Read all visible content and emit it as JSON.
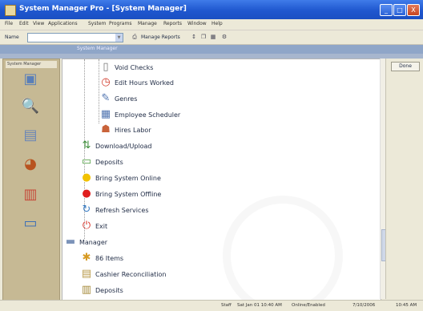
{
  "window": {
    "title": "System Manager Pro - [System Manager]",
    "controls": [
      "_",
      "□",
      "X"
    ]
  },
  "menu": [
    "File",
    "Edit",
    "View",
    "Applications",
    "System",
    "Programs",
    "Manage",
    "Reports",
    "Window",
    "Help"
  ],
  "toolbar": {
    "label": "Name",
    "combo_value": "",
    "print_label": "Manage Reports"
  },
  "header": {
    "title": "System Manager"
  },
  "left_pane": {
    "header": "System Manager",
    "items": [
      {
        "icon": "monitor-icon",
        "glyph": "▣"
      },
      {
        "icon": "magnifier-icon",
        "glyph": "🔍"
      },
      {
        "icon": "clipboard-icon",
        "glyph": "▤"
      },
      {
        "icon": "globe-icon",
        "glyph": "◕"
      },
      {
        "icon": "chart-icon",
        "glyph": "▥"
      },
      {
        "icon": "card-icon",
        "glyph": "▭"
      }
    ]
  },
  "tree": {
    "items": [
      {
        "label": "Void Checks",
        "level": 2,
        "icon": "document-icon",
        "glyph": "▯"
      },
      {
        "label": "Edit Hours Worked",
        "level": 2,
        "icon": "clock-icon",
        "glyph": "◷"
      },
      {
        "label": "Genres",
        "level": 2,
        "icon": "notepad-icon",
        "glyph": "✎"
      },
      {
        "label": "Employee Scheduler",
        "level": 2,
        "icon": "calendar-icon",
        "glyph": "▦"
      },
      {
        "label": "Hires Labor",
        "level": 2,
        "icon": "labor-icon",
        "glyph": "☗"
      },
      {
        "label": "Download/Upload",
        "level": 1,
        "icon": "transfer-icon",
        "glyph": "⇅"
      },
      {
        "label": "Deposits",
        "level": 1,
        "icon": "money-icon",
        "glyph": "▭"
      },
      {
        "label": "Bring System Online",
        "level": 1,
        "icon": "online-icon",
        "glyph": "●"
      },
      {
        "label": "Bring System Offline",
        "level": 1,
        "icon": "offline-icon",
        "glyph": "●"
      },
      {
        "label": "Refresh Services",
        "level": 1,
        "icon": "refresh-icon",
        "glyph": "↻"
      },
      {
        "label": "Exit",
        "level": 1,
        "icon": "exit-icon",
        "glyph": "⏻"
      },
      {
        "label": "Manager",
        "level": 0,
        "icon": "folder-icon",
        "glyph": "▬"
      },
      {
        "label": "86 Items",
        "level": 1,
        "icon": "items-icon",
        "glyph": "✱"
      },
      {
        "label": "Cashier Reconciliation",
        "level": 1,
        "icon": "cashier-icon",
        "glyph": "▤"
      },
      {
        "label": "Deposits",
        "level": 1,
        "icon": "deposit-icon",
        "glyph": "▥"
      }
    ]
  },
  "right_pane": {
    "button_label": "Done"
  },
  "status": {
    "user": "Staff",
    "datetime": "Sat Jan 01 10:40 AM",
    "mode": "Online/Enabled",
    "version": "7/10/2006",
    "time": "10:45 AM"
  },
  "colors": {
    "titlebar": "#2a62d8",
    "online": "#f2c200",
    "offline": "#e01e1e",
    "exit": "#d9342b"
  }
}
